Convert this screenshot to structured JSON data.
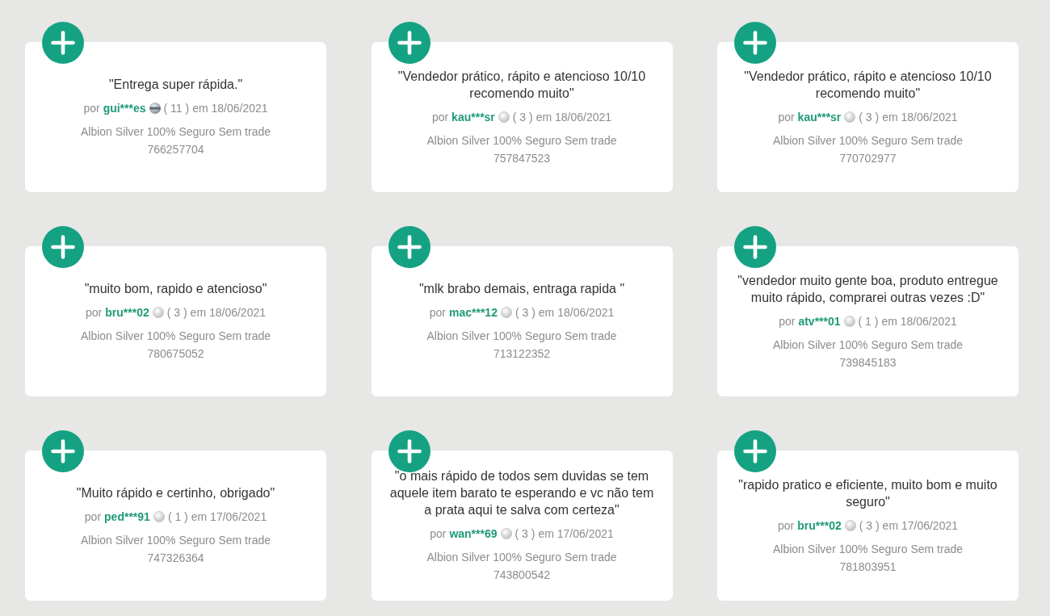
{
  "reviews": [
    {
      "quote": "\"Entrega super rápida.\"",
      "prefix": "por",
      "author": "gui***es",
      "kind": "banded",
      "score": "( 11 )",
      "date": "em 18/06/2021",
      "product": "Albion Silver 100% Seguro Sem trade",
      "order": "766257704"
    },
    {
      "quote": "\"Vendedor prático, rápito e atencioso 10/10 recomendo muito\"",
      "prefix": "por",
      "author": "kau***sr",
      "kind": "plain",
      "score": "( 3 )",
      "date": "em 18/06/2021",
      "product": "Albion Silver 100% Seguro Sem trade",
      "order": "757847523"
    },
    {
      "quote": "\"Vendedor prático, rápito e atencioso 10/10 recomendo muito\"",
      "prefix": "por",
      "author": "kau***sr",
      "kind": "plain",
      "score": "( 3 )",
      "date": "em 18/06/2021",
      "product": "Albion Silver 100% Seguro Sem trade",
      "order": "770702977"
    },
    {
      "quote": "\"muito bom, rapido e atencioso\"",
      "prefix": "por",
      "author": "bru***02",
      "kind": "plain",
      "score": "( 3 )",
      "date": "em 18/06/2021",
      "product": "Albion Silver 100% Seguro Sem trade",
      "order": "780675052"
    },
    {
      "quote": "\"mlk brabo demais, entraga rapida \"",
      "prefix": "por",
      "author": "mac***12",
      "kind": "plain",
      "score": "( 3 )",
      "date": "em 18/06/2021",
      "product": "Albion Silver 100% Seguro Sem trade",
      "order": "713122352"
    },
    {
      "quote": "\"vendedor muito gente boa, produto entregue muito rápido, comprarei outras vezes :D\"",
      "prefix": "por",
      "author": "atv***01",
      "kind": "plain",
      "score": "( 1 )",
      "date": "em 18/06/2021",
      "product": "Albion Silver 100% Seguro Sem trade",
      "order": "739845183"
    },
    {
      "quote": "\"Muito rápido e certinho, obrigado\"",
      "prefix": "por",
      "author": "ped***91",
      "kind": "plain",
      "score": "( 1 )",
      "date": "em 17/06/2021",
      "product": "Albion Silver 100% Seguro Sem trade",
      "order": "747326364"
    },
    {
      "quote": "\"o mais rápido de todos sem duvidas se tem aquele item barato te esperando e vc não tem a prata aqui te salva com certeza\"",
      "prefix": "por",
      "author": "wan***69",
      "kind": "plain",
      "score": "( 3 )",
      "date": "em 17/06/2021",
      "product": "Albion Silver 100% Seguro Sem trade",
      "order": "743800542"
    },
    {
      "quote": "\"rapido pratico e eficiente, muito bom e muito seguro\"",
      "prefix": "por",
      "author": "bru***02",
      "kind": "plain",
      "score": "( 3 )",
      "date": "em 17/06/2021",
      "product": "Albion Silver 100% Seguro Sem trade",
      "order": "781803951"
    }
  ]
}
